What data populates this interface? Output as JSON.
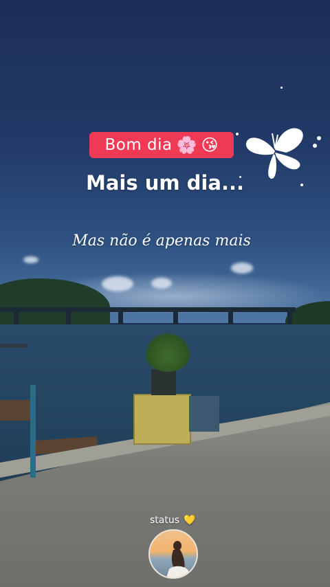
{
  "story": {
    "badge_text": "Bom dia",
    "badge_icons": [
      "🌸",
      "😘"
    ],
    "headline": "Mais um dia...",
    "subline": "Mas não é apenas mais",
    "status_label": "status",
    "status_icon": "💛"
  },
  "colors": {
    "badge_bg": "#ee3a55",
    "text": "#ffffff",
    "sky": "#1c2e57"
  },
  "icons": [
    "cherry-blossom-icon",
    "kiss-face-icon",
    "butterfly-icon",
    "yellow-heart-icon"
  ]
}
